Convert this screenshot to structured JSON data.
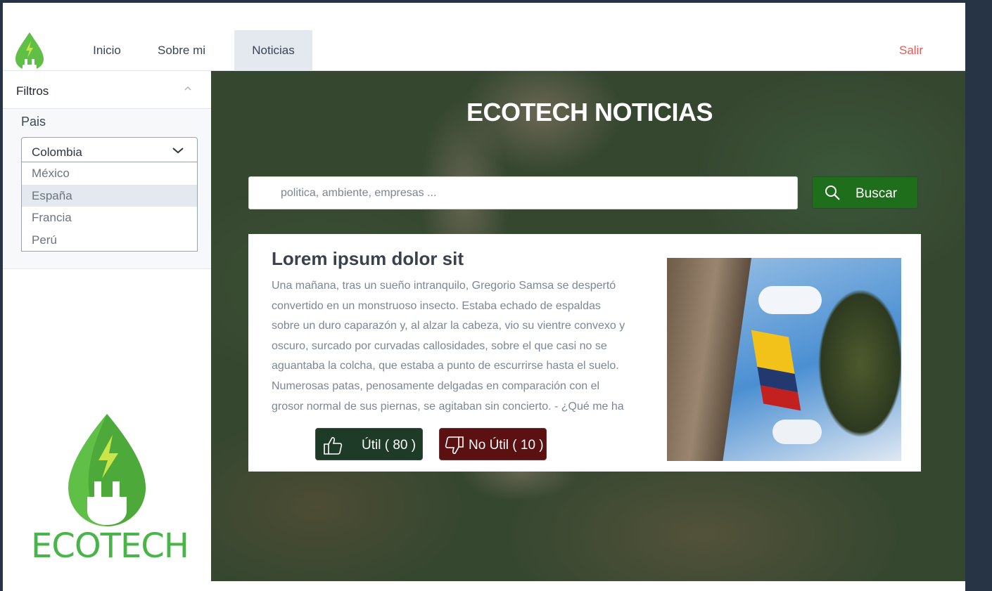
{
  "nav": {
    "items": [
      {
        "label": "Inicio"
      },
      {
        "label": "Sobre mi"
      },
      {
        "label": "Noticias",
        "active": true
      }
    ],
    "logout_label": "Salir"
  },
  "filters": {
    "title": "Filtros",
    "country_label": "Pais",
    "selected": "Colombia",
    "options": [
      "México",
      "España",
      "Francia",
      "Perú"
    ],
    "highlighted": "España"
  },
  "brand": {
    "name": "ECOTECH",
    "color": "#48b548"
  },
  "hero": {
    "title": "ECOTECH NOTICIAS",
    "search_placeholder": "politica, ambiente, empresas ...",
    "search_button": "Buscar"
  },
  "article": {
    "title": "Lorem ipsum dolor sit",
    "body": "Una mañana, tras un sueño intranquilo, Gregorio Samsa se despertó convertido en un monstruoso insecto. Estaba echado de espaldas sobre un duro caparazón y, al alzar la cabeza, vio su vientre convexo y oscuro, surcado por curvadas callosidades, sobre el que casi no se aguantaba la colcha, que estaba a punto de escurrirse hasta el suelo. Numerosas patas, penosamente delgadas en comparación con el grosor normal de sus piernas, se agitaban sin concierto. - ¿Qué me ha",
    "useful_label": "Útil ( 80 )",
    "not_useful_label": "No Útil ( 10 )",
    "image_icon": "colombia-flag-photo"
  },
  "colors": {
    "accent_green": "#1f6e1c",
    "useful_bg": "#1e3b27",
    "not_useful_bg": "#5b1011",
    "logout": "#e05a5a"
  }
}
